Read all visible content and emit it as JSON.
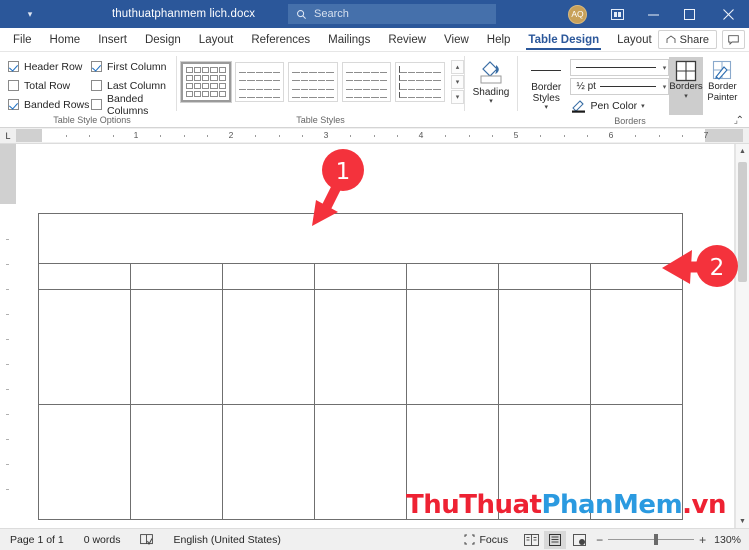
{
  "titlebar": {
    "quick_access_caret": "▾",
    "document_title": "thuthuatphanmem lich.docx",
    "search_placeholder": "Search",
    "avatar_initials": "AQ",
    "ribbon_display_options_label": "Ribbon Display Options",
    "minimize_label": "Minimize",
    "maximize_label": "Maximize",
    "close_label": "Close",
    "accent_color": "#2b579a",
    "search_field_color": "#4570ab",
    "avatar_color": "#c8a15a"
  },
  "tabs": [
    {
      "label": "File",
      "active": false
    },
    {
      "label": "Home",
      "active": false
    },
    {
      "label": "Insert",
      "active": false
    },
    {
      "label": "Design",
      "active": false
    },
    {
      "label": "Layout",
      "active": false
    },
    {
      "label": "References",
      "active": false
    },
    {
      "label": "Mailings",
      "active": false
    },
    {
      "label": "Review",
      "active": false
    },
    {
      "label": "View",
      "active": false
    },
    {
      "label": "Help",
      "active": false
    },
    {
      "label": "Table Design",
      "active": true
    },
    {
      "label": "Layout",
      "active": false
    }
  ],
  "tabstrip_right": {
    "share_label": "Share",
    "comment_label": "Comments"
  },
  "ribbon": {
    "table_style_options": {
      "group_label": "Table Style Options",
      "checkboxes": [
        {
          "label": "Header Row",
          "checked": true
        },
        {
          "label": "First Column",
          "checked": true
        },
        {
          "label": "Total Row",
          "checked": false
        },
        {
          "label": "Last Column",
          "checked": false
        },
        {
          "label": "Banded Rows",
          "checked": true
        },
        {
          "label": "Banded Columns",
          "checked": false
        }
      ]
    },
    "table_styles": {
      "group_label": "Table Styles",
      "thumbnails": [
        {
          "name": "Table Grid",
          "selected": true,
          "variant": "full"
        },
        {
          "name": "Plain Table 1",
          "selected": false,
          "variant": "lines"
        },
        {
          "name": "Plain Table 2",
          "selected": false,
          "variant": "lines"
        },
        {
          "name": "Plain Table 3",
          "selected": false,
          "variant": "lines"
        },
        {
          "name": "Plain Table 4",
          "selected": false,
          "variant": "firstcol"
        }
      ],
      "scroll_up": "▴",
      "scroll_down": "▾",
      "more": "▾"
    },
    "shading": {
      "label": "Shading",
      "caret": "▾"
    },
    "borders_group": {
      "group_label": "Borders",
      "border_styles_label": "Border Styles",
      "border_styles_caret": "▾",
      "line_style_value": "",
      "line_weight_value": "½ pt",
      "pen_color_label": "Pen Color",
      "pen_color_caret": "▾",
      "borders_label": "Borders",
      "borders_caret": "▾",
      "border_painter_label": "Border Painter",
      "dialog_launcher": "⌟",
      "collapse_ribbon": "⌃"
    }
  },
  "ruler": {
    "corner_marker": "L",
    "numbers": [
      "1",
      "2",
      "3",
      "4",
      "5",
      "6",
      "7"
    ],
    "unit": "inches"
  },
  "document": {
    "table": {
      "columns": 7,
      "rows": [
        {
          "type": "merged-header",
          "cells": 1,
          "height_class": "r-head"
        },
        {
          "type": "thin",
          "cells": 7,
          "height_class": "r-thin"
        },
        {
          "type": "tall",
          "cells": 7,
          "height_class": "r-tall"
        },
        {
          "type": "tall",
          "cells": 7,
          "height_class": "r-tall"
        }
      ]
    },
    "watermark": {
      "part1": "ThuThuat",
      "part2": "PhanMem",
      "part3": ".vn",
      "color1": "#ee2233",
      "color2": "#2b9ae0"
    }
  },
  "annotations": [
    {
      "number": "1",
      "points_to": "merged-header-row",
      "direction": "down-left",
      "color": "#f4323c"
    },
    {
      "number": "2",
      "points_to": "second-row-right-edge",
      "direction": "left",
      "color": "#f4323c"
    }
  ],
  "statusbar": {
    "page_label": "Page 1 of 1",
    "word_count": "0 words",
    "proofing_icon_label": "proofing-errors",
    "language": "English (United States)",
    "focus_label": "Focus",
    "read_mode_label": "Read Mode",
    "print_layout_label": "Print Layout",
    "web_layout_label": "Web Layout",
    "zoom_out": "−",
    "zoom_in": "+",
    "zoom_level": "130%"
  }
}
